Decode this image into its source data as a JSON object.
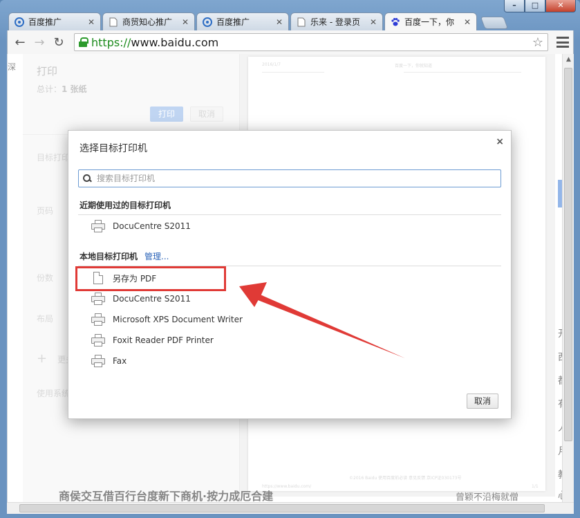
{
  "browser": {
    "tabs": [
      {
        "label": "百度推广",
        "icon": "baidu-promo-icon"
      },
      {
        "label": "商贸知心推广",
        "icon": "page-icon"
      },
      {
        "label": "百度推广",
        "icon": "baidu-promo-icon"
      },
      {
        "label": "乐来 - 登录页",
        "icon": "page-icon"
      },
      {
        "label": "百度一下，你",
        "icon": "baidu-paw-icon"
      }
    ],
    "url_scheme": "https://",
    "url_host": "www.baidu.com",
    "window_controls": {
      "min": "–",
      "max": "□",
      "close": "✕"
    }
  },
  "print_panel": {
    "title": "打印",
    "total_label": "总计：",
    "total_value": "1 张纸",
    "print_button": "打印",
    "cancel_button": "取消",
    "labels": [
      "目标打印",
      "页码",
      "份数",
      "布局"
    ],
    "more_label": "更多",
    "system_label": "使用系统"
  },
  "preview": {
    "date": "2016/1/7",
    "header_title": "百度一下，你就知道",
    "footer_url": "https://www.baidu.com/",
    "footer_page": "1/1",
    "footer_copyright": "©2016 Baidu 使用百度前必读 意见反馈 京ICP证030173号"
  },
  "background": {
    "left_edge_char": "深",
    "bottom_headline": "商侯交互借百行台度新下商机·按力成厄合建",
    "bottom_right": "曾颖不沿梅就僧",
    "right_chars": [
      "开",
      "西",
      "都",
      "有",
      "人",
      "月",
      "教",
      "心"
    ]
  },
  "dialog": {
    "title": "选择目标打印机",
    "close": "×",
    "search_placeholder": "搜索目标打印机",
    "recent_title": "近期使用过的目标打印机",
    "recent_printers": [
      "DocuCentre S2011"
    ],
    "local_title": "本地目标打印机",
    "manage_link": "管理...",
    "save_pdf": "另存为 PDF",
    "local_printers": [
      "DocuCentre S2011",
      "Microsoft XPS Document Writer",
      "Foxit Reader PDF Printer",
      "Fax"
    ],
    "cancel_button": "取消"
  },
  "colors": {
    "highlight": "#e03a36",
    "link": "#2a63b8",
    "print_button": "#8db3e8"
  }
}
